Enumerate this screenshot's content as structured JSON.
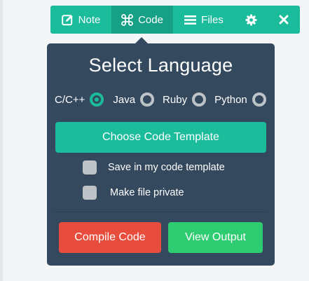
{
  "toolbar": {
    "note_label": "Note",
    "code_label": "Code",
    "files_label": "Files",
    "active_tab": "Code",
    "icons": [
      "edit-icon",
      "command-icon",
      "list-icon",
      "gear-icon",
      "close-icon"
    ]
  },
  "panel": {
    "title": "Select Language",
    "languages": [
      {
        "label": "C/C++",
        "selected": true
      },
      {
        "label": "Java",
        "selected": false
      },
      {
        "label": "Ruby",
        "selected": false
      },
      {
        "label": "Python",
        "selected": false
      }
    ],
    "template_button": "Choose Code Template",
    "options": [
      {
        "label": "Save in my code template",
        "checked": false
      },
      {
        "label": "Make file private",
        "checked": false
      }
    ],
    "compile_button": "Compile Code",
    "output_button": "View Output"
  },
  "colors": {
    "toolbar": "#1abc9c",
    "toolbar_active": "#16a085",
    "panel": "#34495e",
    "compile": "#e74c3c",
    "output": "#2ecc71",
    "control_grey": "#bdc3c7"
  }
}
